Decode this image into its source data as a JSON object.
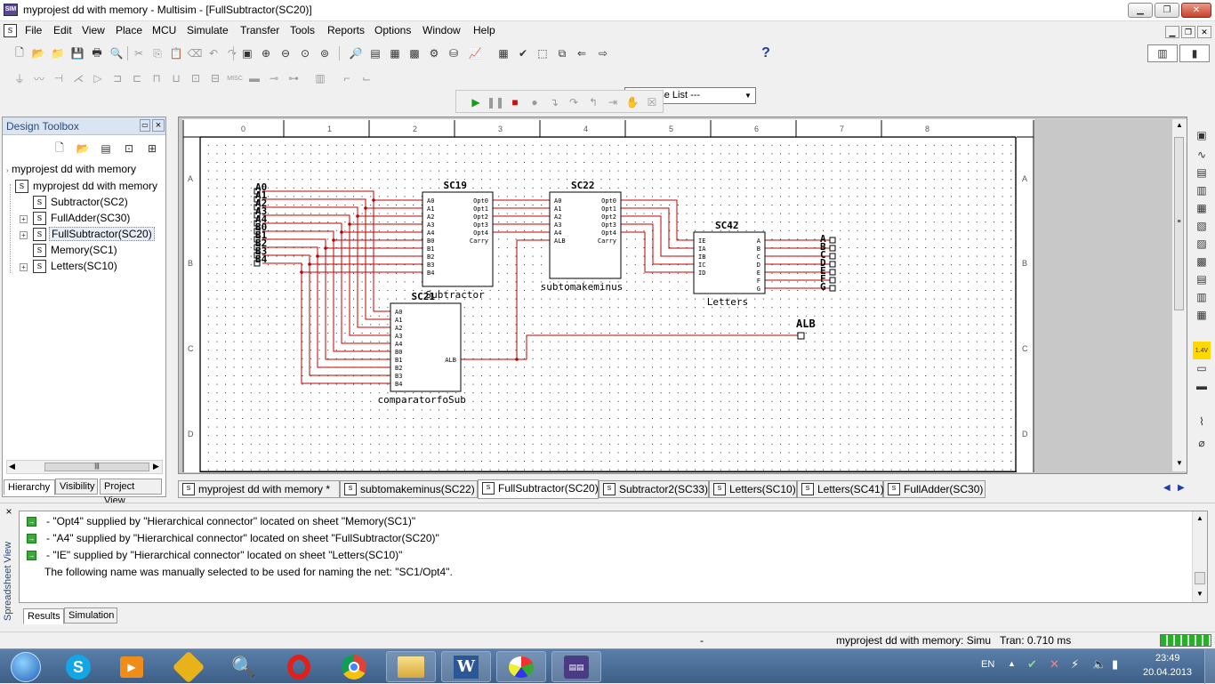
{
  "window": {
    "title": "myprojest dd with memory - Multisim - [FullSubtractor(SC20)]",
    "app_icon": "multisim-icon",
    "controls": [
      "minimize-icon",
      "restore-icon",
      "close-icon"
    ]
  },
  "menu": [
    "File",
    "Edit",
    "View",
    "Place",
    "MCU",
    "Simulate",
    "Transfer",
    "Tools",
    "Reports",
    "Options",
    "Window",
    "Help"
  ],
  "toolbar": {
    "in_use_list": "--- In Use List ---",
    "help_glyph": "?"
  },
  "toolbox": {
    "title": "Design Toolbox",
    "close_glyph": "×",
    "items": [
      {
        "label": "myprojest dd with memory"
      },
      {
        "label": "myprojest dd with memory"
      },
      {
        "label": "Subtractor(SC2)"
      },
      {
        "label": "FullAdder(SC30)"
      },
      {
        "label": "FullSubtractor(SC20)"
      },
      {
        "label": "Memory(SC1)"
      },
      {
        "label": "Letters(SC10)"
      }
    ],
    "tabs": [
      "Hierarchy",
      "Visibility",
      "Project View"
    ]
  },
  "sheet": {
    "col_labels": [
      "0",
      "1",
      "2",
      "3",
      "4",
      "5",
      "6",
      "7",
      "8"
    ],
    "row_labels": [
      "A",
      "B",
      "C",
      "D"
    ],
    "blocks": {
      "sc19": {
        "ref": "SC19",
        "name": "Subtractor",
        "inputs": [
          "A0",
          "A1",
          "A2",
          "A3",
          "A4",
          "B0",
          "B1",
          "B2",
          "B3",
          "B4"
        ],
        "outputs": [
          "Opt0",
          "Opt1",
          "Opt2",
          "Opt3",
          "Opt4",
          "Carry"
        ]
      },
      "sc22": {
        "ref": "SC22",
        "name": "subtomakeminus",
        "inputs": [
          "A0",
          "A1",
          "A2",
          "A3",
          "A4",
          "ALB"
        ],
        "outputs": [
          "Opt0",
          "Opt1",
          "Opt2",
          "Opt3",
          "Opt4",
          "Carry"
        ]
      },
      "sc42": {
        "ref": "SC42",
        "name": "Letters",
        "inputs": [
          "IE",
          "IA",
          "IB",
          "IC",
          "ID"
        ],
        "outputs": [
          "A",
          "B",
          "C",
          "D",
          "E",
          "F",
          "G"
        ]
      },
      "sc21": {
        "ref": "SC21",
        "name": "comparatorfoSub",
        "inputs": [
          "A0",
          "A1",
          "A2",
          "A3",
          "A4",
          "B0",
          "B1",
          "B2",
          "B3",
          "B4"
        ],
        "outputs": [
          "ALB"
        ]
      }
    },
    "connectors_left": [
      "A0",
      "A1",
      "A2",
      "A3",
      "A4",
      "B0",
      "B1",
      "B2",
      "B3",
      "B4"
    ],
    "connectors_right": [
      "A",
      "B",
      "C",
      "D",
      "E",
      "F",
      "G"
    ],
    "connector_alb": "ALB",
    "wire_color": "#c00000"
  },
  "sheet_tabs": [
    {
      "label": "myprojest dd with memory *"
    },
    {
      "label": "subtomakeminus(SC22)"
    },
    {
      "label": "FullSubtractor(SC20)",
      "active": true
    },
    {
      "label": "Subtractor2(SC33)"
    },
    {
      "label": "Letters(SC10)"
    },
    {
      "label": "Letters(SC41)"
    },
    {
      "label": "FullAdder(SC30)"
    }
  ],
  "output": {
    "side_label": "Spreadsheet View",
    "close_glyph": "×",
    "lines": [
      "- \"Opt4\" supplied by \"Hierarchical connector\" located on sheet \"Memory(SC1)\"",
      "- \"A4\" supplied by \"Hierarchical connector\" located on sheet \"FullSubtractor(SC20)\"",
      "- \"IE\" supplied by \"Hierarchical connector\" located on sheet \"Letters(SC10)\"",
      "The following name was manually selected to be used for naming the net: \"SC1/Opt4\"."
    ],
    "tabs": [
      "Results",
      "Simulation"
    ]
  },
  "status": {
    "middle": "-",
    "project": "myprojest dd with memory: Simu",
    "tran": "Tran: 0.710 ms"
  },
  "taskbar": {
    "apps": [
      "start-orb-icon",
      "skype-icon",
      "media-player-icon",
      "power-tool-icon",
      "search-magnifier-icon",
      "opera-icon",
      "chrome-icon",
      "file-explorer-icon",
      "word-icon",
      "paint-icon",
      "multisim-icon"
    ],
    "lang": "EN",
    "time": "23:49",
    "date": "20.04.2013"
  }
}
